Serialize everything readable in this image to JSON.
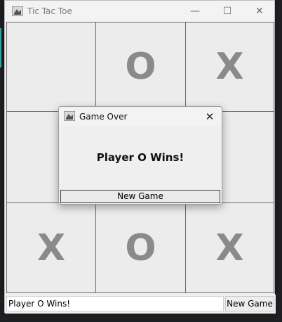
{
  "window": {
    "title": "Tic Tac Toe",
    "controls": {
      "minimize": "—",
      "maximize": "☐",
      "close": "✕"
    }
  },
  "board": {
    "cells": [
      {
        "row": 1,
        "col": 1,
        "mark": ""
      },
      {
        "row": 1,
        "col": 2,
        "mark": "O"
      },
      {
        "row": 1,
        "col": 3,
        "mark": "X"
      },
      {
        "row": 2,
        "col": 1,
        "mark": ""
      },
      {
        "row": 2,
        "col": 2,
        "mark": ""
      },
      {
        "row": 2,
        "col": 3,
        "mark": ""
      },
      {
        "row": 3,
        "col": 1,
        "mark": "X"
      },
      {
        "row": 3,
        "col": 2,
        "mark": "O"
      },
      {
        "row": 3,
        "col": 3,
        "mark": "X"
      }
    ]
  },
  "status": {
    "text": "Player O Wins!",
    "button_label": "New Game"
  },
  "dialog": {
    "title": "Game Over",
    "close": "✕",
    "message": "Player O Wins!",
    "button_label": "New Game"
  }
}
